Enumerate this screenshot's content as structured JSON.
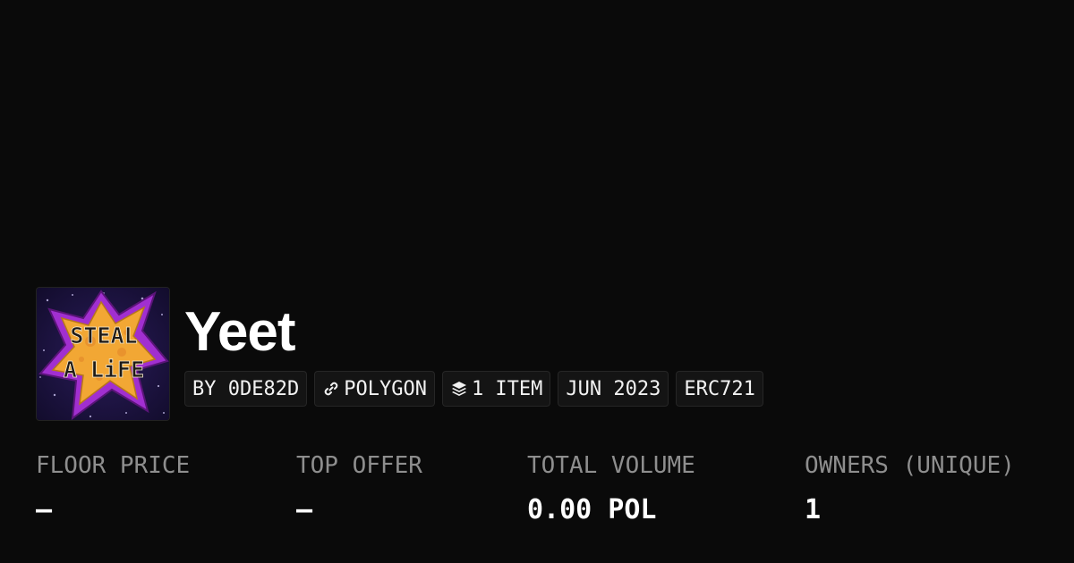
{
  "collection": {
    "name": "Yeet",
    "avatar_text_line1": "STEAL",
    "avatar_text_line2": "A LiFE"
  },
  "tags": {
    "creator": "BY 0DE82D",
    "chain": "POLYGON",
    "items": "1 ITEM",
    "date": "JUN 2023",
    "standard": "ERC721"
  },
  "stats": {
    "floor_price": {
      "label": "FLOOR PRICE",
      "value": "–"
    },
    "top_offer": {
      "label": "TOP OFFER",
      "value": "–"
    },
    "total_volume": {
      "label": "TOTAL VOLUME",
      "value": "0.00 POL"
    },
    "owners": {
      "label": "OWNERS (UNIQUE)",
      "value": "1"
    }
  },
  "icons": {
    "chain": "link-icon",
    "items": "layers-icon"
  },
  "colors": {
    "background": "#0a0a0a",
    "label": "#8e8e8e",
    "tag_background": "#141414",
    "tag_border": "#262626"
  }
}
